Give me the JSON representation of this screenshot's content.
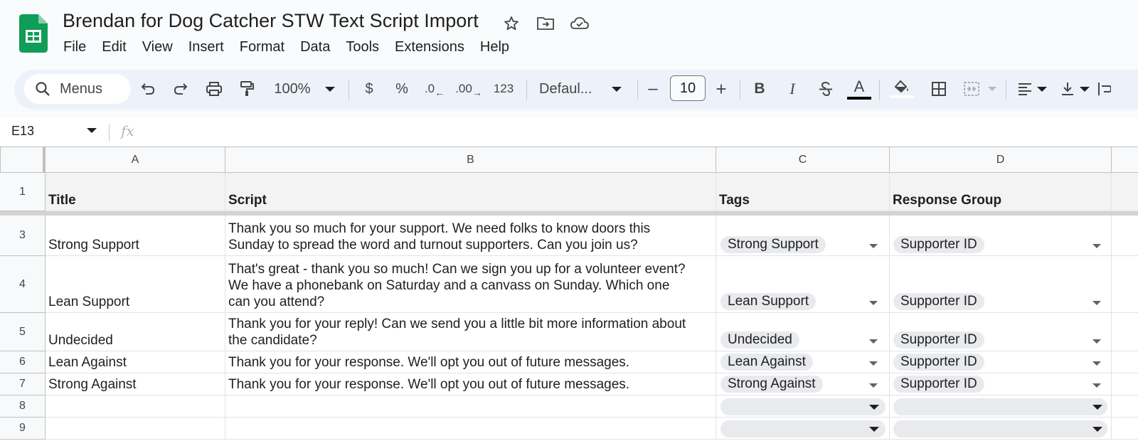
{
  "app": {
    "doc_title": "Brendan for Dog Catcher STW Text Script Import",
    "menus": [
      "File",
      "Edit",
      "View",
      "Insert",
      "Format",
      "Data",
      "Tools",
      "Extensions",
      "Help"
    ]
  },
  "toolbar": {
    "search_label": "Menus",
    "zoom": "100%",
    "currency": "$",
    "percent": "%",
    "dec_decrease": ".0",
    "dec_increase": ".00",
    "number_format": "123",
    "font": "Defaul...",
    "font_size": "10",
    "bold": "B",
    "italic": "I",
    "text_color_letter": "A",
    "minus": "–",
    "plus": "+"
  },
  "formula_bar": {
    "name_box": "E13",
    "fx": "fx",
    "value": ""
  },
  "columns": [
    "A",
    "B",
    "C",
    "D"
  ],
  "header_row": {
    "row_num": "1",
    "cells": [
      "Title",
      "Script",
      "Tags",
      "Response Group"
    ]
  },
  "rows": [
    {
      "num": "3",
      "title": "Strong Support",
      "script": [
        "Thank you so much for your support. We need folks to know doors this",
        "Sunday to spread the word and turnout supporters. Can you join us?"
      ],
      "tag": "Strong Support",
      "group": "Supporter ID"
    },
    {
      "num": "4",
      "title": "Lean Support",
      "script": [
        "That's great - thank you so much! Can we sign you up for a volunteer event?",
        "We have a phonebank on Saturday and a canvass on Sunday. Which one",
        "can you attend?"
      ],
      "tag": "Lean Support",
      "group": "Supporter ID"
    },
    {
      "num": "5",
      "title": "Undecided",
      "script": [
        "Thank you for your reply! Can we send you a little bit more information about",
        "the candidate?"
      ],
      "tag": "Undecided",
      "group": "Supporter ID"
    },
    {
      "num": "6",
      "title": "Lean Against",
      "script": [
        "Thank you for your response. We'll opt you out of future messages."
      ],
      "tag": "Lean Against",
      "group": "Supporter ID"
    },
    {
      "num": "7",
      "title": "Strong Against",
      "script": [
        "Thank you for your response. We'll opt you out of future messages."
      ],
      "tag": "Strong Against",
      "group": "Supporter ID"
    },
    {
      "num": "8",
      "title": "",
      "script": [
        ""
      ],
      "tag": "",
      "group": ""
    },
    {
      "num": "9",
      "title": "",
      "script": [
        ""
      ],
      "tag": "",
      "group": ""
    }
  ],
  "colors": {
    "sheets_green": "#0f9d58",
    "toolbar_bg": "#edf2fa",
    "chip_bg": "#e8eaed",
    "header_bg": "#f3f3f3"
  }
}
